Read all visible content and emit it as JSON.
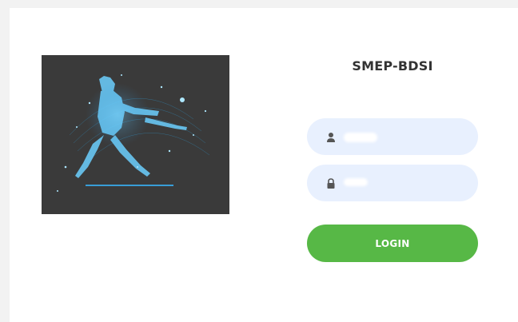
{
  "app": {
    "title": "SMEP-BDSI"
  },
  "form": {
    "username": {
      "value": "",
      "placeholder": "",
      "icon": "user-icon"
    },
    "password": {
      "value": "",
      "placeholder": "",
      "icon": "lock-icon"
    },
    "login_label": "LOGIN"
  },
  "colors": {
    "accent": "#57b846",
    "field_bg": "#e8f0fe",
    "image_bg": "#3a3a3a",
    "glow": "#38b6ff"
  }
}
